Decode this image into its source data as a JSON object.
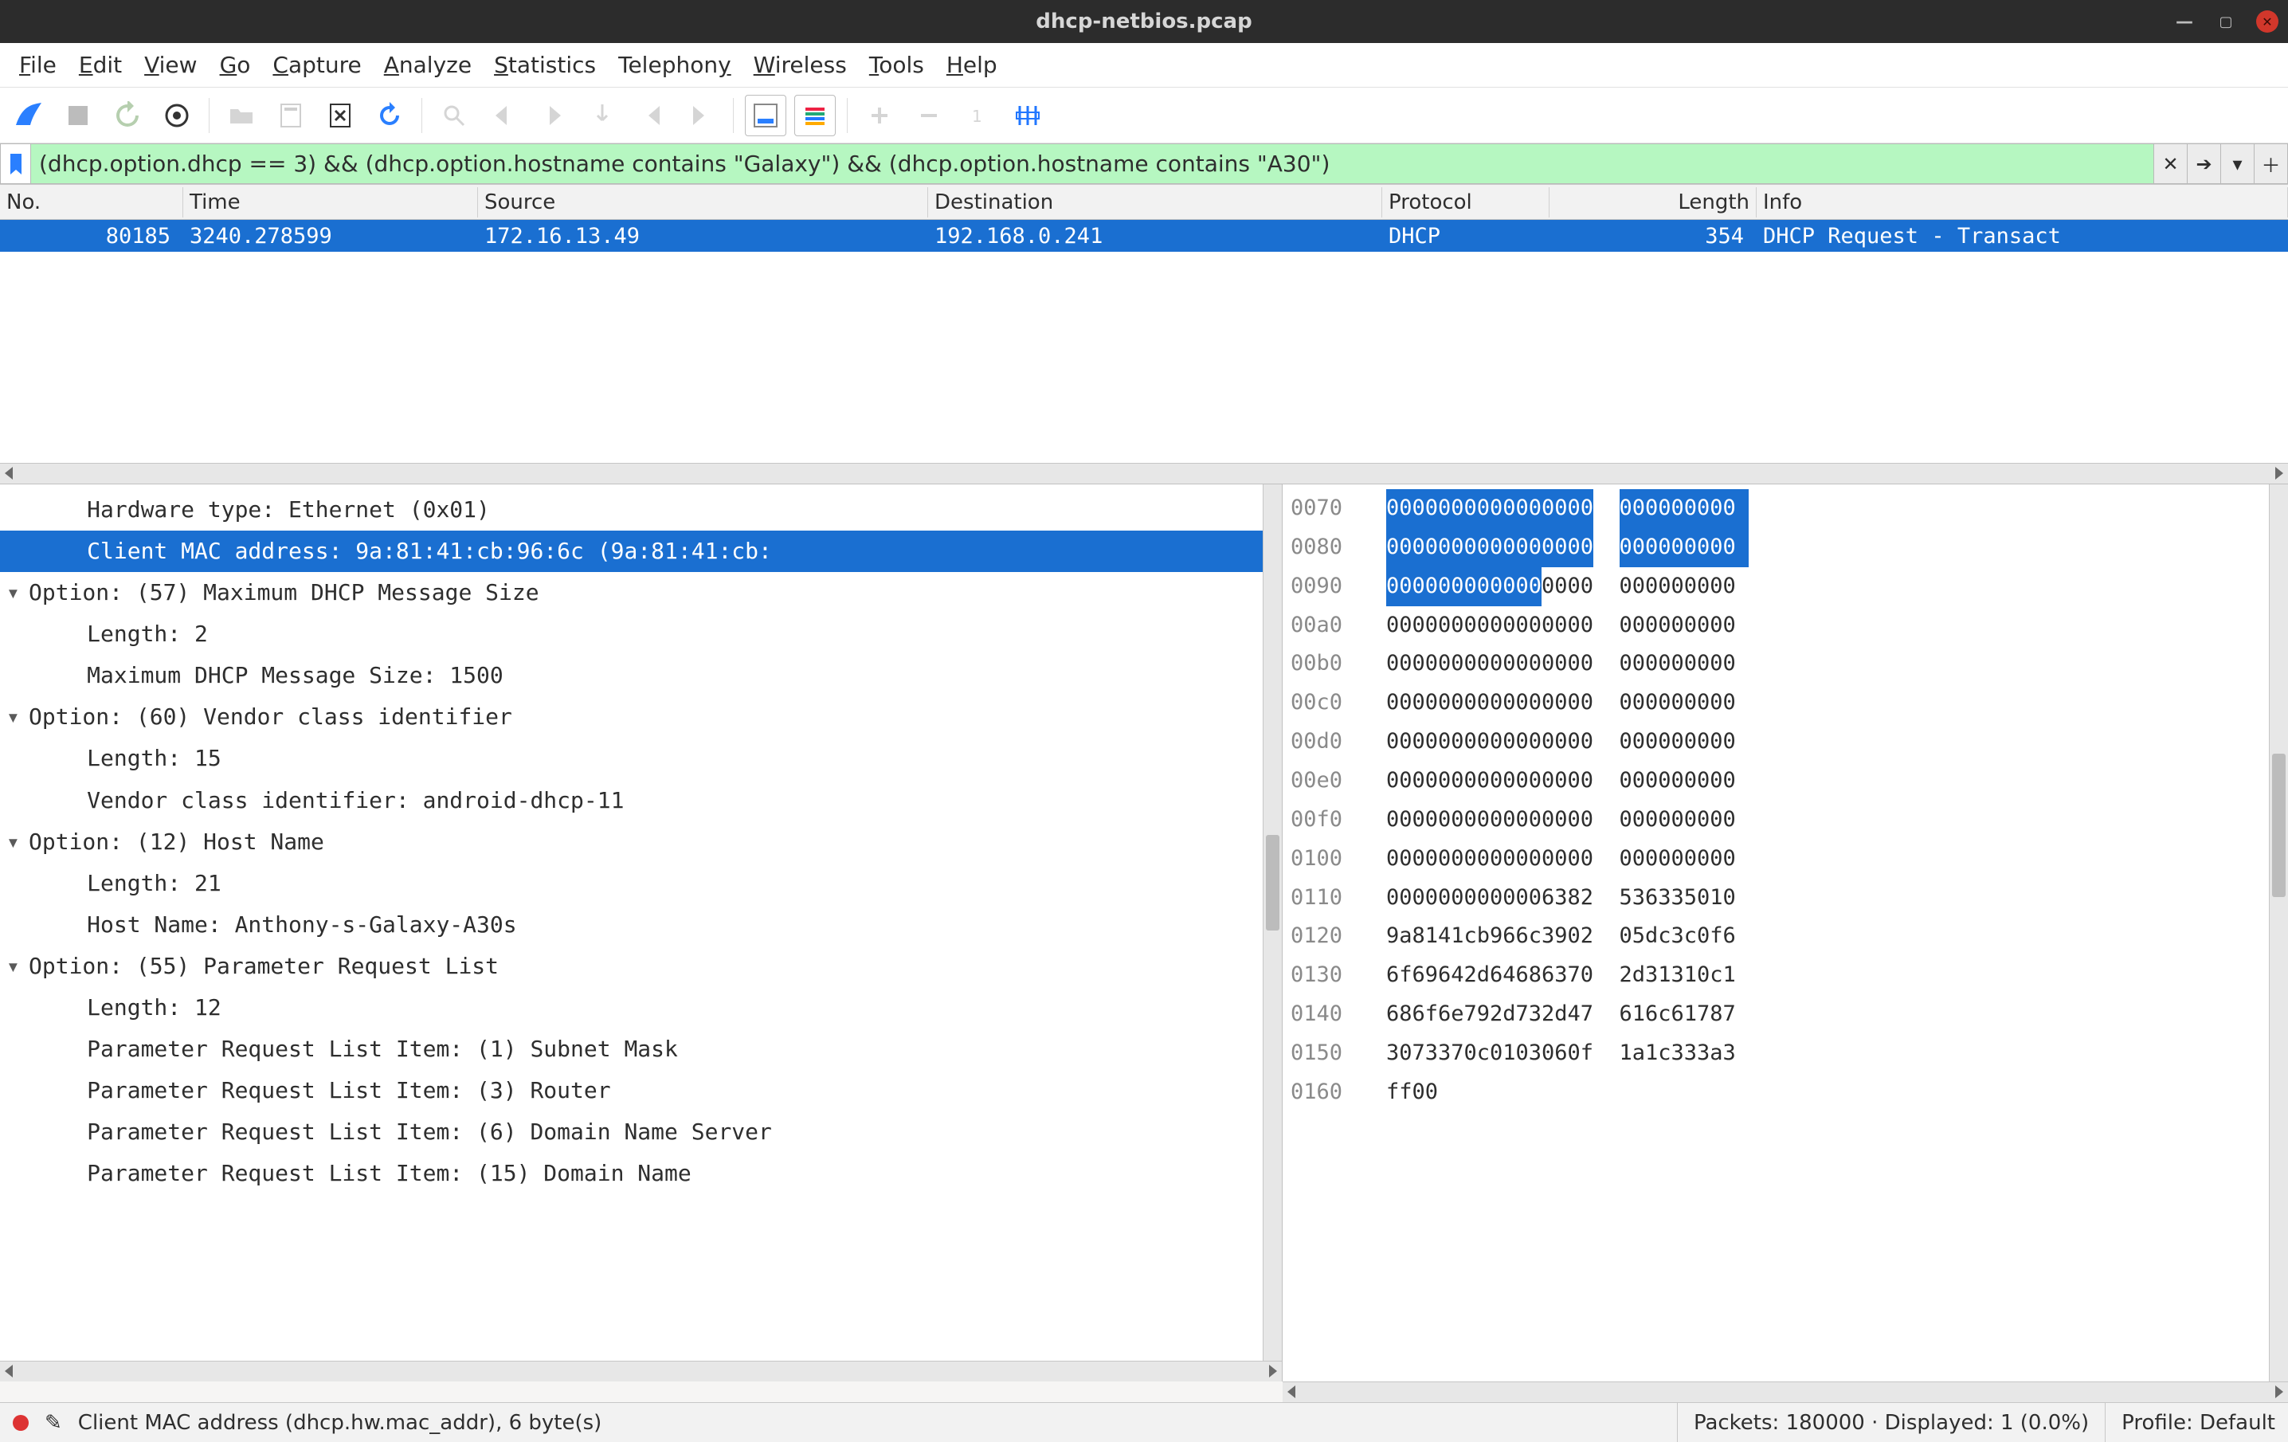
{
  "window": {
    "title": "dhcp-netbios.pcap"
  },
  "menubar": [
    "File",
    "Edit",
    "View",
    "Go",
    "Capture",
    "Analyze",
    "Statistics",
    "Telephony",
    "Wireless",
    "Tools",
    "Help"
  ],
  "toolbar": {
    "icons": [
      "shark-fin-icon",
      "stop-icon",
      "restart-icon",
      "options-gear-icon",
      "open-file-icon",
      "save-file-icon",
      "close-file-icon",
      "reload-icon",
      "find-icon",
      "back-icon",
      "forward-icon",
      "jump-icon",
      "goto-first-icon",
      "goto-last-icon",
      "auto-scroll-icon",
      "colorize-icon",
      "zoom-in-icon",
      "zoom-out-icon",
      "zoom-reset-icon",
      "resize-columns-icon"
    ]
  },
  "filter": {
    "value": "(dhcp.option.dhcp == 3) && (dhcp.option.hostname contains \"Galaxy\") && (dhcp.option.hostname contains \"A30\")",
    "valid": true
  },
  "packet_list": {
    "columns": [
      "No.",
      "Time",
      "Source",
      "Destination",
      "Protocol",
      "Length",
      "Info"
    ],
    "rows": [
      {
        "no": "80185",
        "time": "3240.278599",
        "src": "172.16.13.49",
        "dst": "192.168.0.241",
        "proto": "DHCP",
        "len": "354",
        "info": "DHCP Request   - Transact"
      }
    ],
    "selected_index": 0
  },
  "tree": {
    "lines": [
      {
        "indent": 1,
        "expander": "",
        "text": "Hardware type: Ethernet (0x01)",
        "selected": false
      },
      {
        "indent": 1,
        "expander": "",
        "text": "Client MAC address: 9a:81:41:cb:96:6c (9a:81:41:cb:",
        "selected": true
      },
      {
        "indent": 0,
        "expander": "▾",
        "text": "Option: (57) Maximum DHCP Message Size",
        "selected": false
      },
      {
        "indent": 1,
        "expander": "",
        "text": "Length: 2",
        "selected": false
      },
      {
        "indent": 1,
        "expander": "",
        "text": "Maximum DHCP Message Size: 1500",
        "selected": false
      },
      {
        "indent": 0,
        "expander": "▾",
        "text": "Option: (60) Vendor class identifier",
        "selected": false
      },
      {
        "indent": 1,
        "expander": "",
        "text": "Length: 15",
        "selected": false
      },
      {
        "indent": 1,
        "expander": "",
        "text": "Vendor class identifier: android-dhcp-11",
        "selected": false
      },
      {
        "indent": 0,
        "expander": "▾",
        "text": "Option: (12) Host Name",
        "selected": false
      },
      {
        "indent": 1,
        "expander": "",
        "text": "Length: 21",
        "selected": false
      },
      {
        "indent": 1,
        "expander": "",
        "text": "Host Name: Anthony-s-Galaxy-A30s",
        "selected": false
      },
      {
        "indent": 0,
        "expander": "▾",
        "text": "Option: (55) Parameter Request List",
        "selected": false
      },
      {
        "indent": 1,
        "expander": "",
        "text": "Length: 12",
        "selected": false
      },
      {
        "indent": 1,
        "expander": "",
        "text": "Parameter Request List Item: (1) Subnet Mask",
        "selected": false
      },
      {
        "indent": 1,
        "expander": "",
        "text": "Parameter Request List Item: (3) Router",
        "selected": false
      },
      {
        "indent": 1,
        "expander": "",
        "text": "Parameter Request List Item: (6) Domain Name Server",
        "selected": false
      },
      {
        "indent": 1,
        "expander": "",
        "text": "Parameter Request List Item: (15) Domain Name",
        "selected": false
      }
    ]
  },
  "hex": {
    "selected_bytes": {
      "from_row": 0,
      "to_row": 2,
      "to_col": 5
    },
    "rows": [
      {
        "off": "0070",
        "b": [
          "00",
          "00",
          "00",
          "00",
          "00",
          "00",
          "00",
          "00",
          "",
          "00",
          "00",
          "00",
          "00",
          "0"
        ]
      },
      {
        "off": "0080",
        "b": [
          "00",
          "00",
          "00",
          "00",
          "00",
          "00",
          "00",
          "00",
          "",
          "00",
          "00",
          "00",
          "00",
          "0"
        ]
      },
      {
        "off": "0090",
        "b": [
          "00",
          "00",
          "00",
          "00",
          "00",
          "00",
          "00",
          "00",
          "",
          "00",
          "00",
          "00",
          "00",
          "0"
        ]
      },
      {
        "off": "00a0",
        "b": [
          "00",
          "00",
          "00",
          "00",
          "00",
          "00",
          "00",
          "00",
          "",
          "00",
          "00",
          "00",
          "00",
          "0"
        ]
      },
      {
        "off": "00b0",
        "b": [
          "00",
          "00",
          "00",
          "00",
          "00",
          "00",
          "00",
          "00",
          "",
          "00",
          "00",
          "00",
          "00",
          "0"
        ]
      },
      {
        "off": "00c0",
        "b": [
          "00",
          "00",
          "00",
          "00",
          "00",
          "00",
          "00",
          "00",
          "",
          "00",
          "00",
          "00",
          "00",
          "0"
        ]
      },
      {
        "off": "00d0",
        "b": [
          "00",
          "00",
          "00",
          "00",
          "00",
          "00",
          "00",
          "00",
          "",
          "00",
          "00",
          "00",
          "00",
          "0"
        ]
      },
      {
        "off": "00e0",
        "b": [
          "00",
          "00",
          "00",
          "00",
          "00",
          "00",
          "00",
          "00",
          "",
          "00",
          "00",
          "00",
          "00",
          "0"
        ]
      },
      {
        "off": "00f0",
        "b": [
          "00",
          "00",
          "00",
          "00",
          "00",
          "00",
          "00",
          "00",
          "",
          "00",
          "00",
          "00",
          "00",
          "0"
        ]
      },
      {
        "off": "0100",
        "b": [
          "00",
          "00",
          "00",
          "00",
          "00",
          "00",
          "00",
          "00",
          "",
          "00",
          "00",
          "00",
          "00",
          "0"
        ]
      },
      {
        "off": "0110",
        "b": [
          "00",
          "00",
          "00",
          "00",
          "00",
          "00",
          "63",
          "82",
          "",
          "53",
          "63",
          "35",
          "01",
          "0"
        ]
      },
      {
        "off": "0120",
        "b": [
          "9a",
          "81",
          "41",
          "cb",
          "96",
          "6c",
          "39",
          "02",
          "",
          "05",
          "dc",
          "3c",
          "0f",
          "6"
        ]
      },
      {
        "off": "0130",
        "b": [
          "6f",
          "69",
          "64",
          "2d",
          "64",
          "68",
          "63",
          "70",
          "",
          "2d",
          "31",
          "31",
          "0c",
          "1"
        ]
      },
      {
        "off": "0140",
        "b": [
          "68",
          "6f",
          "6e",
          "79",
          "2d",
          "73",
          "2d",
          "47",
          "",
          "61",
          "6c",
          "61",
          "78",
          "7"
        ]
      },
      {
        "off": "0150",
        "b": [
          "30",
          "73",
          "37",
          "0c",
          "01",
          "03",
          "06",
          "0f",
          "",
          "1a",
          "1c",
          "33",
          "3a",
          "3"
        ]
      },
      {
        "off": "0160",
        "b": [
          "ff",
          "00",
          "",
          "",
          "",
          "",
          "",
          "",
          "",
          "",
          "",
          "",
          "",
          ""
        ]
      }
    ]
  },
  "statusbar": {
    "field": "Client MAC address (dhcp.hw.mac_addr), 6 byte(s)",
    "packets": "Packets: 180000 · Displayed: 1 (0.0%)",
    "profile": "Profile: Default"
  },
  "colors": {
    "selection": "#1a6fd1",
    "filter_valid_bg": "#b6f7c1"
  }
}
